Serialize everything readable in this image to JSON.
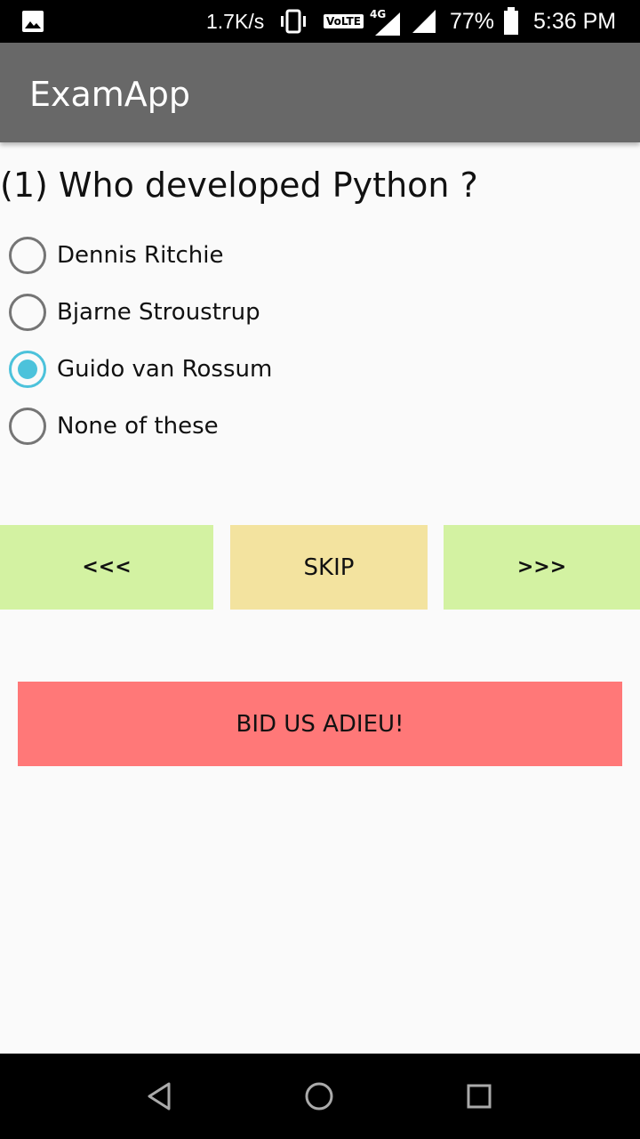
{
  "status_bar": {
    "net_speed": "1.7K/s",
    "volte": "VoLTE",
    "network": "4G",
    "battery": "77%",
    "time": "5:36 PM",
    "icons": [
      "gallery-icon",
      "vibrate-icon",
      "signal-icon",
      "battery-icon"
    ]
  },
  "app_bar": {
    "title": "ExamApp"
  },
  "quiz": {
    "question": "(1) Who developed Python ?",
    "options": [
      {
        "label": "Dennis Ritchie",
        "selected": false
      },
      {
        "label": "Bjarne Stroustrup",
        "selected": false
      },
      {
        "label": "Guido van Rossum",
        "selected": true
      },
      {
        "label": "None of these",
        "selected": false
      }
    ],
    "accent_color": "#4cc2db"
  },
  "buttons": {
    "prev": "<<<",
    "skip": "SKIP",
    "next": ">>>",
    "quit": "BID US ADIEU!"
  },
  "colors": {
    "app_bar": "#686868",
    "nav_buttons": "#d3f2a2",
    "skip_button": "#f3e39f",
    "quit_button": "#ff7878"
  }
}
